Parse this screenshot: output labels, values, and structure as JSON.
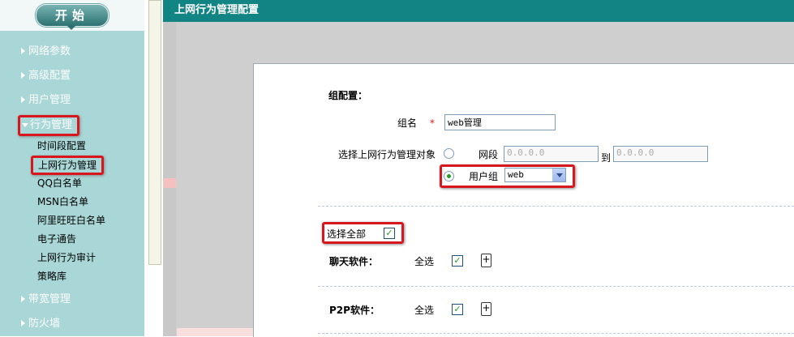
{
  "sidebar": {
    "start_label": "开始",
    "items": [
      {
        "label": "网络参数"
      },
      {
        "label": "高级配置"
      },
      {
        "label": "用户管理"
      },
      {
        "label": "行为管理"
      },
      {
        "label": "带宽管理"
      },
      {
        "label": "防火墙"
      }
    ],
    "sub_items": [
      {
        "label": "时间段配置"
      },
      {
        "label": "上网行为管理"
      },
      {
        "label": "QQ白名单"
      },
      {
        "label": "MSN白名单"
      },
      {
        "label": "阿里旺旺白名单"
      },
      {
        "label": "电子通告"
      },
      {
        "label": "上网行为审计"
      },
      {
        "label": "策略库"
      }
    ]
  },
  "header": {
    "title": "上网行为管理配置"
  },
  "form": {
    "section_title": "组配置：",
    "group_name_label": "组名",
    "required_mark": "*",
    "group_name_value": "web管理",
    "target_label": "选择上网行为管理对象",
    "segment_label": "网段",
    "ip_start_placeholder": "0.0.0.0",
    "to_label": "到",
    "ip_end_placeholder": "0.0.0.0",
    "user_group_label": "用户组",
    "user_group_value": "web",
    "select_all_label": "选择全部",
    "rows": [
      {
        "label": "聊天软件：",
        "all_label": "全选",
        "plus": "+"
      },
      {
        "label": "P2P软件：",
        "all_label": "全选",
        "plus": "+"
      }
    ]
  },
  "colors": {
    "header_bg": "#138484",
    "sidebar_bg": "#a9d6d6",
    "highlight": "#d8161d"
  }
}
